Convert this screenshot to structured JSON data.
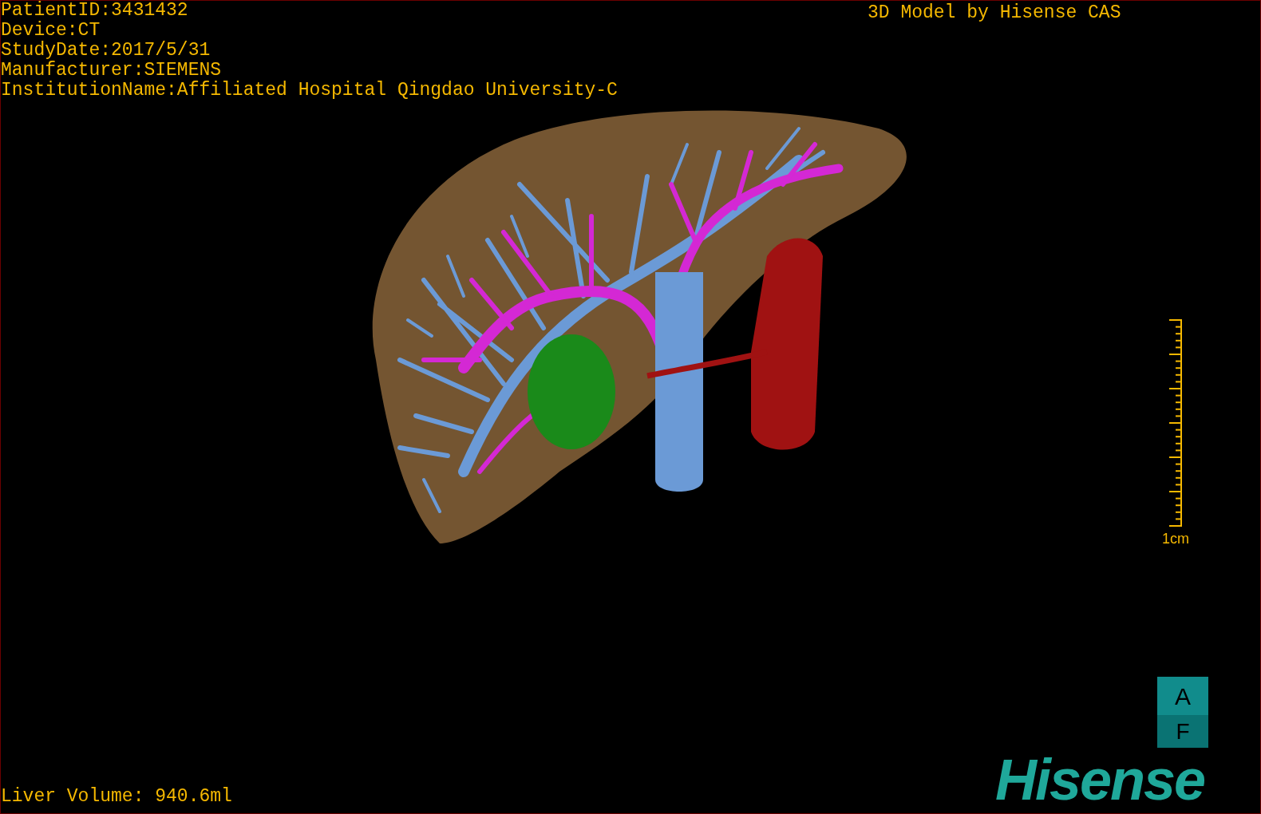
{
  "patient_info": [
    "PatientID:3431432",
    "Device:CT",
    "StudyDate:2017/5/31",
    "Manufacturer:SIEMENS",
    "InstitutionName:Affiliated Hospital Qingdao University-C"
  ],
  "credit": "3D Model by Hisense CAS",
  "scale_bar": {
    "label": "1cm"
  },
  "orientation_cube": {
    "top": "A",
    "bottom": "F"
  },
  "logo": "Hisense",
  "liver_volume": "Liver Volume: 940.6ml"
}
